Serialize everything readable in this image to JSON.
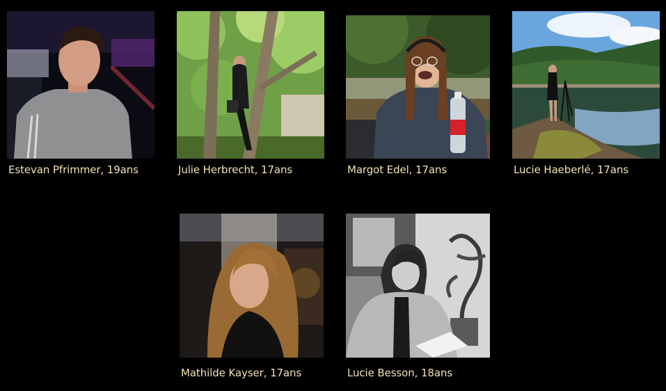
{
  "theme": {
    "background": "#000000",
    "caption_color": "#f2e3b3"
  },
  "gallery": {
    "people": [
      {
        "caption": "Estevan Pfrimmer, 19ans",
        "photo_icon": "portrait-photo"
      },
      {
        "caption": "Julie Herbrecht, 17ans",
        "photo_icon": "portrait-photo"
      },
      {
        "caption": "Margot Edel, 17ans",
        "photo_icon": "portrait-photo"
      },
      {
        "caption": "Lucie Haeberlé, 17ans",
        "photo_icon": "portrait-photo"
      },
      {
        "caption": "Mathilde Kayser, 17ans",
        "photo_icon": "portrait-photo"
      },
      {
        "caption": "Lucie Besson, 18ans",
        "photo_icon": "portrait-photo"
      }
    ]
  }
}
